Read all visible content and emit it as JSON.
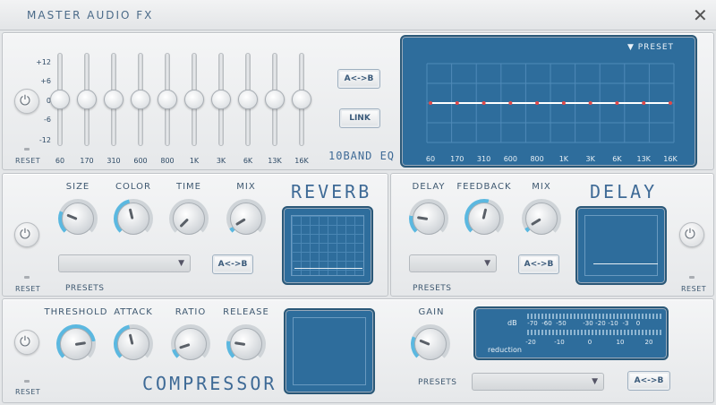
{
  "window": {
    "title": "MASTER AUDIO FX",
    "close_icon": "✕"
  },
  "eq": {
    "scale": [
      "+12",
      "+6",
      "0",
      "-6",
      "-12"
    ],
    "bands": [
      {
        "label": "60",
        "value": 0
      },
      {
        "label": "170",
        "value": 0
      },
      {
        "label": "310",
        "value": 0
      },
      {
        "label": "600",
        "value": 0
      },
      {
        "label": "800",
        "value": 0
      },
      {
        "label": "1K",
        "value": 0
      },
      {
        "label": "3K",
        "value": 0
      },
      {
        "label": "6K",
        "value": 0
      },
      {
        "label": "13K",
        "value": 0
      },
      {
        "label": "16K",
        "value": 0
      }
    ],
    "ab_label": "A<->B",
    "link_label": "LINK",
    "name": "10BAND EQ",
    "preset_label": "PRESET",
    "reset_label": "RESET"
  },
  "reverb": {
    "name": "REVERB",
    "knobs": [
      {
        "label": "SIZE",
        "value": 0.25
      },
      {
        "label": "COLOR",
        "value": 0.45
      },
      {
        "label": "TIME",
        "value": 0.0
      },
      {
        "label": "MIX",
        "value": 0.05
      }
    ],
    "presets_label": "PRESETS",
    "ab_label": "A<->B",
    "reset_label": "RESET"
  },
  "delay": {
    "name": "DELAY",
    "knobs": [
      {
        "label": "DELAY",
        "value": 0.2
      },
      {
        "label": "FEEDBACK",
        "value": 0.55
      },
      {
        "label": "MIX",
        "value": 0.05
      }
    ],
    "presets_label": "PRESETS",
    "ab_label": "A<->B",
    "reset_label": "RESET"
  },
  "compressor": {
    "name": "COMPRESSOR",
    "knobs": [
      {
        "label": "THRESHOLD",
        "value": 0.8
      },
      {
        "label": "ATTACK",
        "value": 0.45
      },
      {
        "label": "RATIO",
        "value": 0.1
      },
      {
        "label": "RELEASE",
        "value": 0.2
      }
    ],
    "gain_label": "GAIN",
    "gain_value": 0.25,
    "meter": {
      "top_label": "dB",
      "bottom_label": "reduction",
      "top_scale": [
        "-70",
        "-60",
        "-50",
        "-30",
        "-20",
        "-10",
        "-3",
        "0"
      ],
      "bottom_scale": [
        "-20",
        "-10",
        "0",
        "10",
        "20"
      ]
    },
    "presets_label": "PRESETS",
    "ab_label": "A<->B",
    "reset_label": "RESET"
  },
  "colors": {
    "accent": "#3e6a96",
    "screen": "#2e6d9c",
    "knob_ring": "#5bb8e0"
  }
}
